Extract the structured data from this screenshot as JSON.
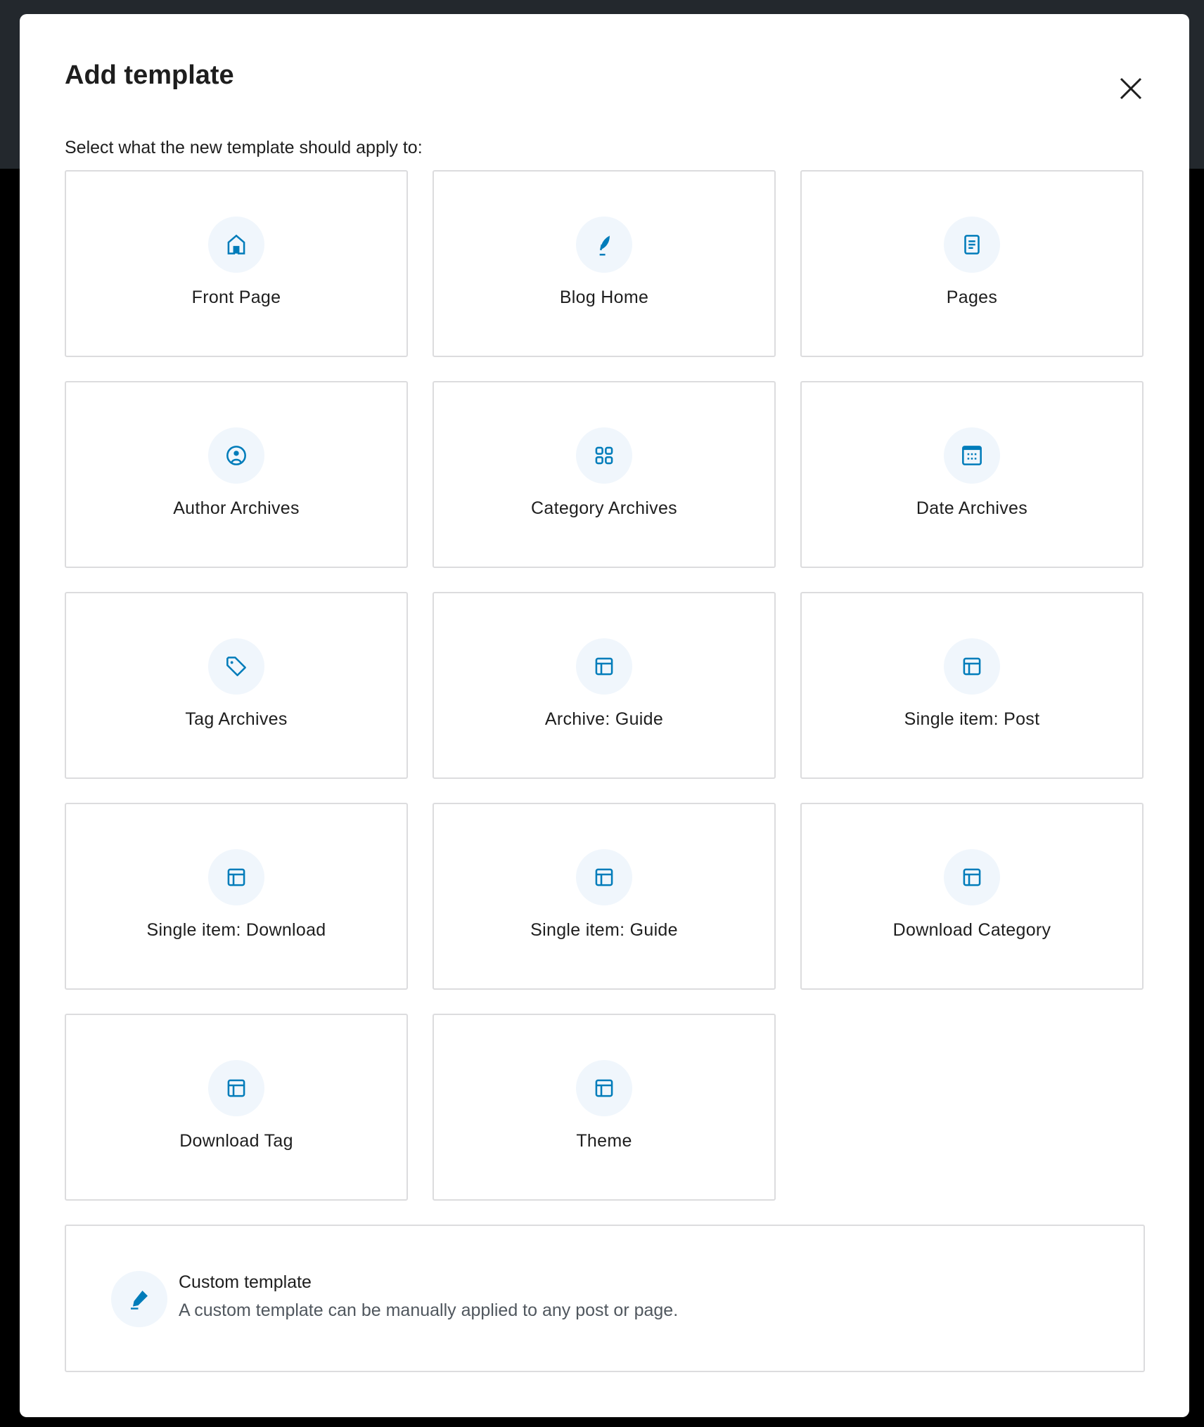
{
  "dialog": {
    "title": "Add template",
    "subtitle": "Select what the new template should apply to:",
    "close_icon": "close-icon",
    "accent_color": "#007cba",
    "items": [
      {
        "label": "Front Page",
        "icon": "home-icon"
      },
      {
        "label": "Blog Home",
        "icon": "feather-icon"
      },
      {
        "label": "Pages",
        "icon": "page-icon"
      },
      {
        "label": "Author Archives",
        "icon": "user-circle-icon"
      },
      {
        "label": "Category Archives",
        "icon": "category-icon"
      },
      {
        "label": "Date Archives",
        "icon": "calendar-icon"
      },
      {
        "label": "Tag Archives",
        "icon": "tag-icon"
      },
      {
        "label": "Archive: Guide",
        "icon": "layout-icon"
      },
      {
        "label": "Single item: Post",
        "icon": "layout-icon"
      },
      {
        "label": "Single item: Download",
        "icon": "layout-icon"
      },
      {
        "label": "Single item: Guide",
        "icon": "layout-icon"
      },
      {
        "label": "Download Category",
        "icon": "layout-icon"
      },
      {
        "label": "Download Tag",
        "icon": "layout-icon"
      },
      {
        "label": "Theme",
        "icon": "layout-icon"
      }
    ],
    "custom": {
      "title": "Custom template",
      "description": "A custom template can be manually applied to any post or page.",
      "icon": "pencil-icon"
    }
  }
}
